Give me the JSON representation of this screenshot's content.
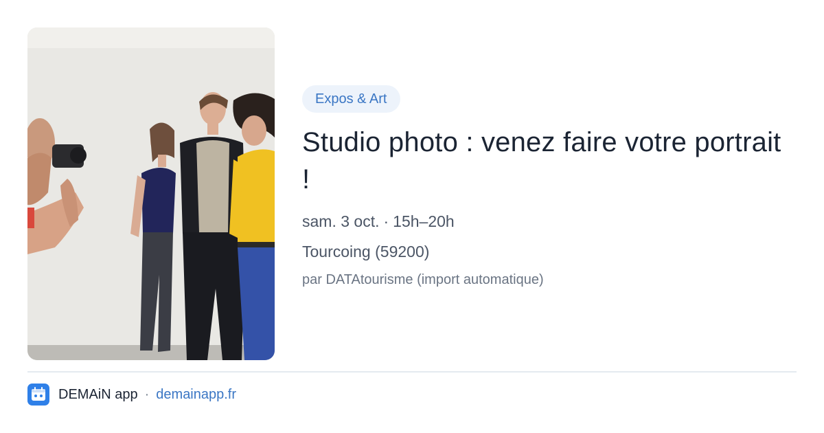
{
  "category": {
    "label": "Expos & Art"
  },
  "event": {
    "title": "Studio photo : venez faire votre portrait !",
    "date": "sam. 3 oct.",
    "time": "15h–20h",
    "date_separator": "·",
    "location": "Tourcoing (59200)",
    "source": "par DATAtourisme (import automatique)"
  },
  "footer": {
    "app_name": "DEMAiN app",
    "separator": "·",
    "domain": "demainapp.fr"
  },
  "colors": {
    "accent": "#3a76c4",
    "badge_bg": "#edf3fb",
    "text": "#1b2433",
    "muted": "#4b5565",
    "app_icon": "#2f80e8"
  }
}
